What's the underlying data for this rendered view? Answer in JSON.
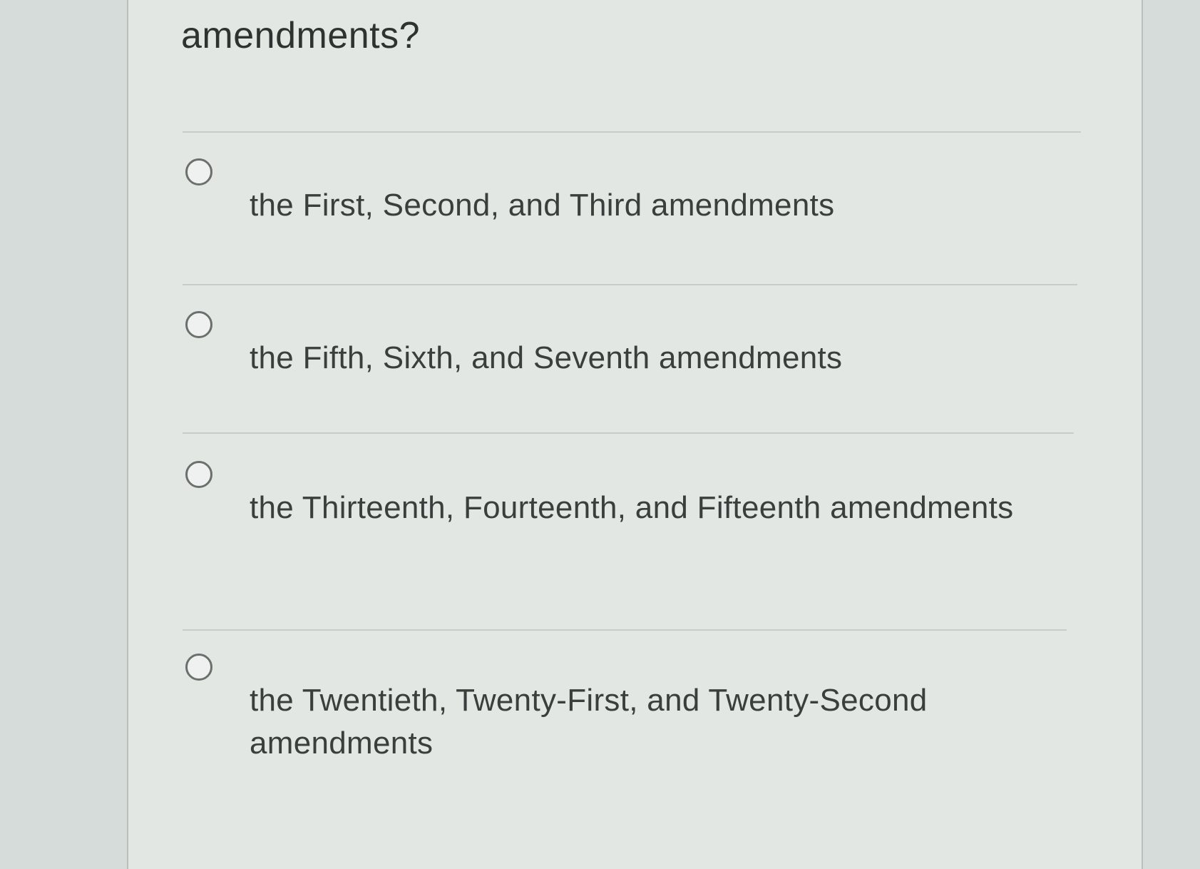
{
  "question": {
    "text": "amendments?"
  },
  "options": [
    {
      "label": "the First, Second, and Third amendments",
      "selected": false
    },
    {
      "label": "the Fifth, Sixth, and Seventh amendments",
      "selected": false
    },
    {
      "label": "the Thirteenth, Fourteenth, and Fifteenth amendments",
      "selected": false
    },
    {
      "label": "the Twentieth, Twenty-First, and Twenty-Second amendments",
      "selected": false
    }
  ]
}
